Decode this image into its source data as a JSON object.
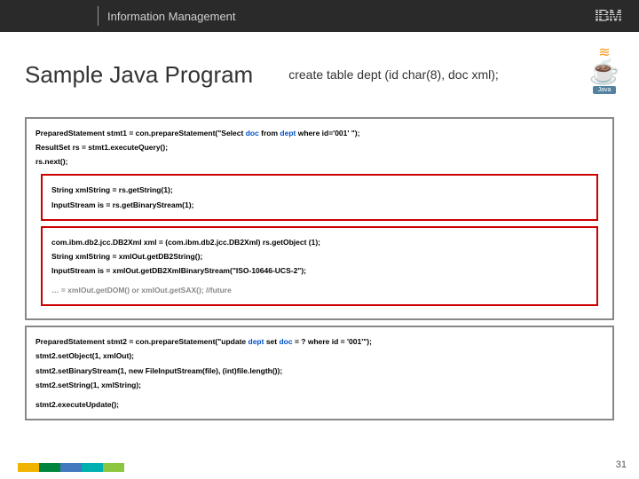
{
  "header": {
    "product_line": "Information Management",
    "logo_text": "IBM"
  },
  "title": "Sample Java Program",
  "subtitle": "create table dept (id char(8), doc xml);",
  "java_logo_label": "Java",
  "code_block1": {
    "line1_a": "PreparedStatement stmt1 = con.prepareStatement(\"Select ",
    "line1_b": "doc ",
    "line1_c": "from ",
    "line1_d": "dept ",
    "line1_e": "where id='001' \");",
    "line2": "ResultSet rs = stmt1.executeQuery();",
    "line3": "rs.next();",
    "line4": "String xmlString = rs.getString(1);",
    "line5": "InputStream is = rs.getBinaryStream(1);",
    "line6": "com.ibm.db2.jcc.DB2Xml xml = (com.ibm.db2.jcc.DB2Xml) rs.getObject (1);",
    "line7": "String xmlString = xmlOut.getDB2String();",
    "line8": "InputStream is  = xmlOut.getDB2XmlBinaryStream(\"ISO-10646-UCS-2\");",
    "line9": "… = xmlOut.getDOM()  or  xmlOut.getSAX();  //future"
  },
  "code_block2": {
    "line1_a": "PreparedStatement stmt2 = con.prepareStatement(\"update ",
    "line1_b": "dept ",
    "line1_c": "set ",
    "line1_d": "doc ",
    "line1_e": "= ? where id = '001'\");",
    "line2": "stmt2.setObject(1, xmlOut);",
    "line3": "stmt2.setBinaryStream(1, new FileInputStream(file), (int)file.length());",
    "line4": "stmt2.setString(1, xmlString);",
    "line5": "stmt2.executeUpdate();"
  },
  "page_number": "31"
}
